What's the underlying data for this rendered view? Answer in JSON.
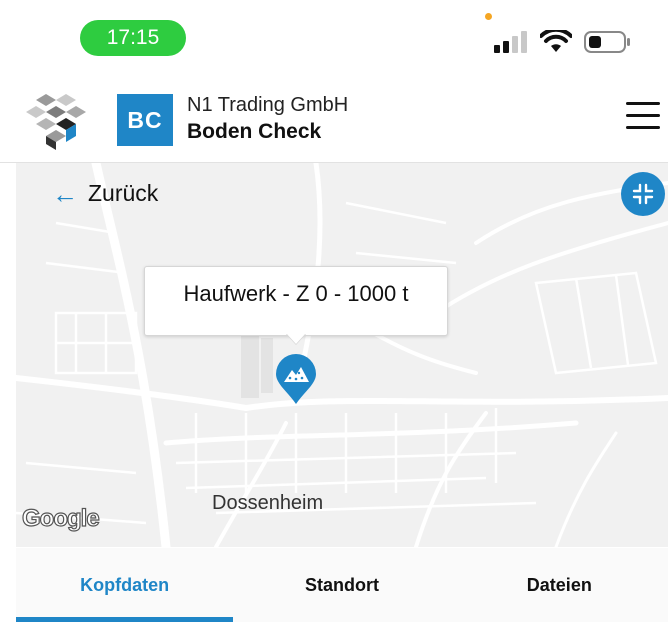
{
  "status_bar": {
    "time": "17:15",
    "icons": [
      "signal-icon",
      "wifi-icon",
      "battery-icon"
    ]
  },
  "header": {
    "badge_text": "BC",
    "company": "N1 Trading GmbH",
    "product": "Boden Check",
    "menu_icon": "hamburger-menu-icon"
  },
  "map": {
    "back_label": "Zurück",
    "callout_text": "Haufwerk - Z 0 - 1000 t",
    "place_label": "Dossenheim",
    "attribution": "Google",
    "collapse_icon": "collapse-icon",
    "pin_icon": "stockpile-pin-icon"
  },
  "tabs": [
    {
      "label": "Kopfdaten",
      "active": true
    },
    {
      "label": "Standort",
      "active": false
    },
    {
      "label": "Dateien",
      "active": false
    }
  ],
  "colors": {
    "accent": "#1f86c7",
    "time_pill": "#2ecc40"
  }
}
